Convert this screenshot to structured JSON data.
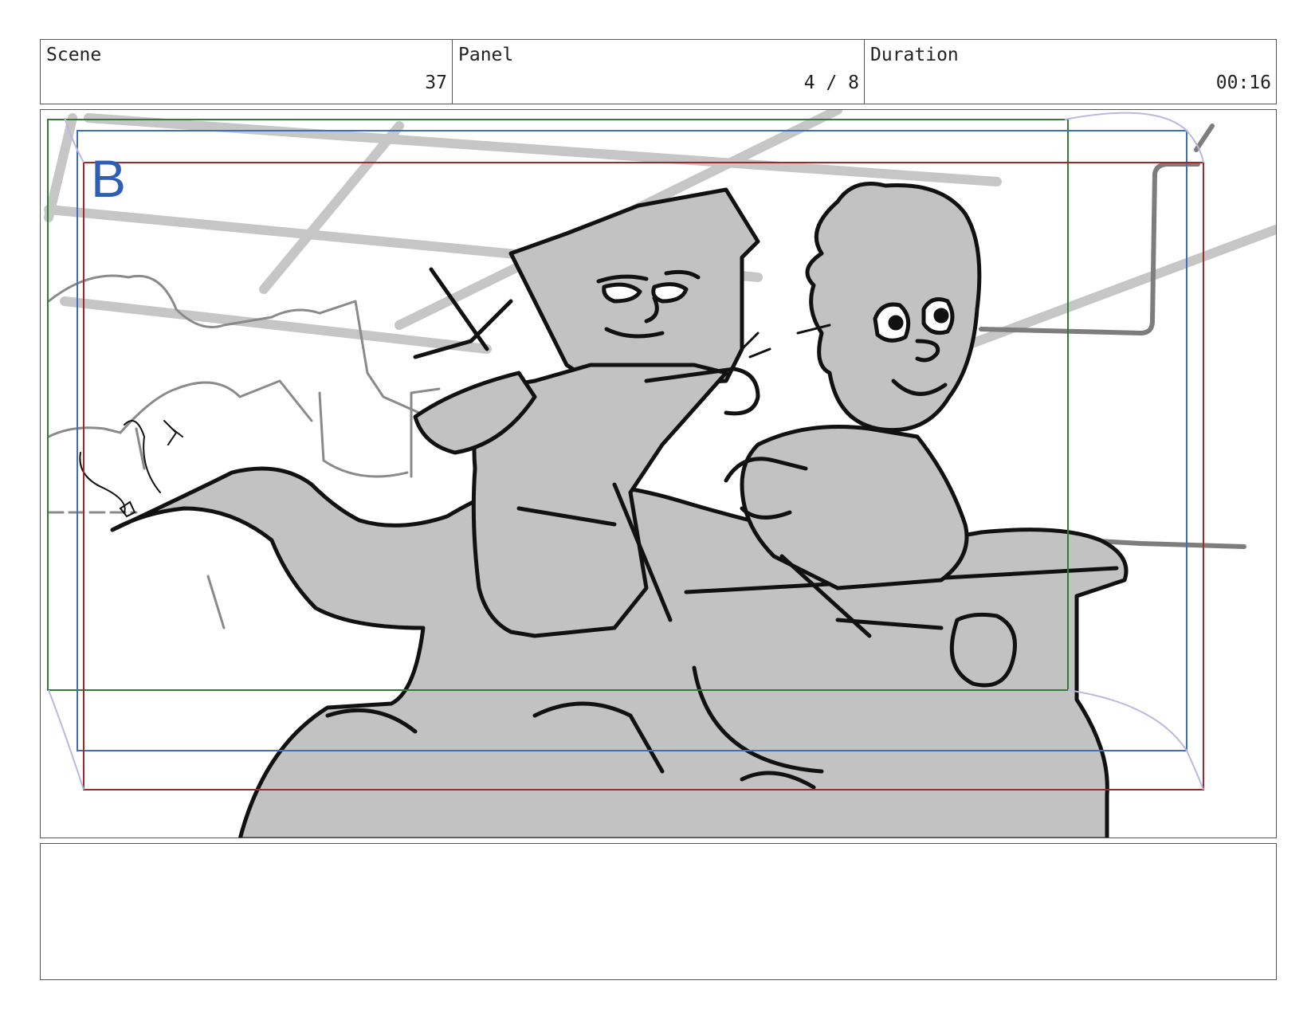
{
  "header": {
    "scene_label": "Scene",
    "scene_value": "37",
    "panel_label": "Panel",
    "panel_value": "4 / 8",
    "duration_label": "Duration",
    "duration_value": "00:16"
  },
  "frame": {
    "panel_letter": "B",
    "colors": {
      "safe_green": "#2e7d32",
      "safe_blue": "#3a6fc4",
      "safe_red": "#a3262a",
      "fill_gray": "#c2c2c2",
      "bg_lines": "#c6c6c6",
      "ink": "#111111",
      "letter": "#2f5fb3"
    }
  },
  "notes": {
    "text": ""
  }
}
